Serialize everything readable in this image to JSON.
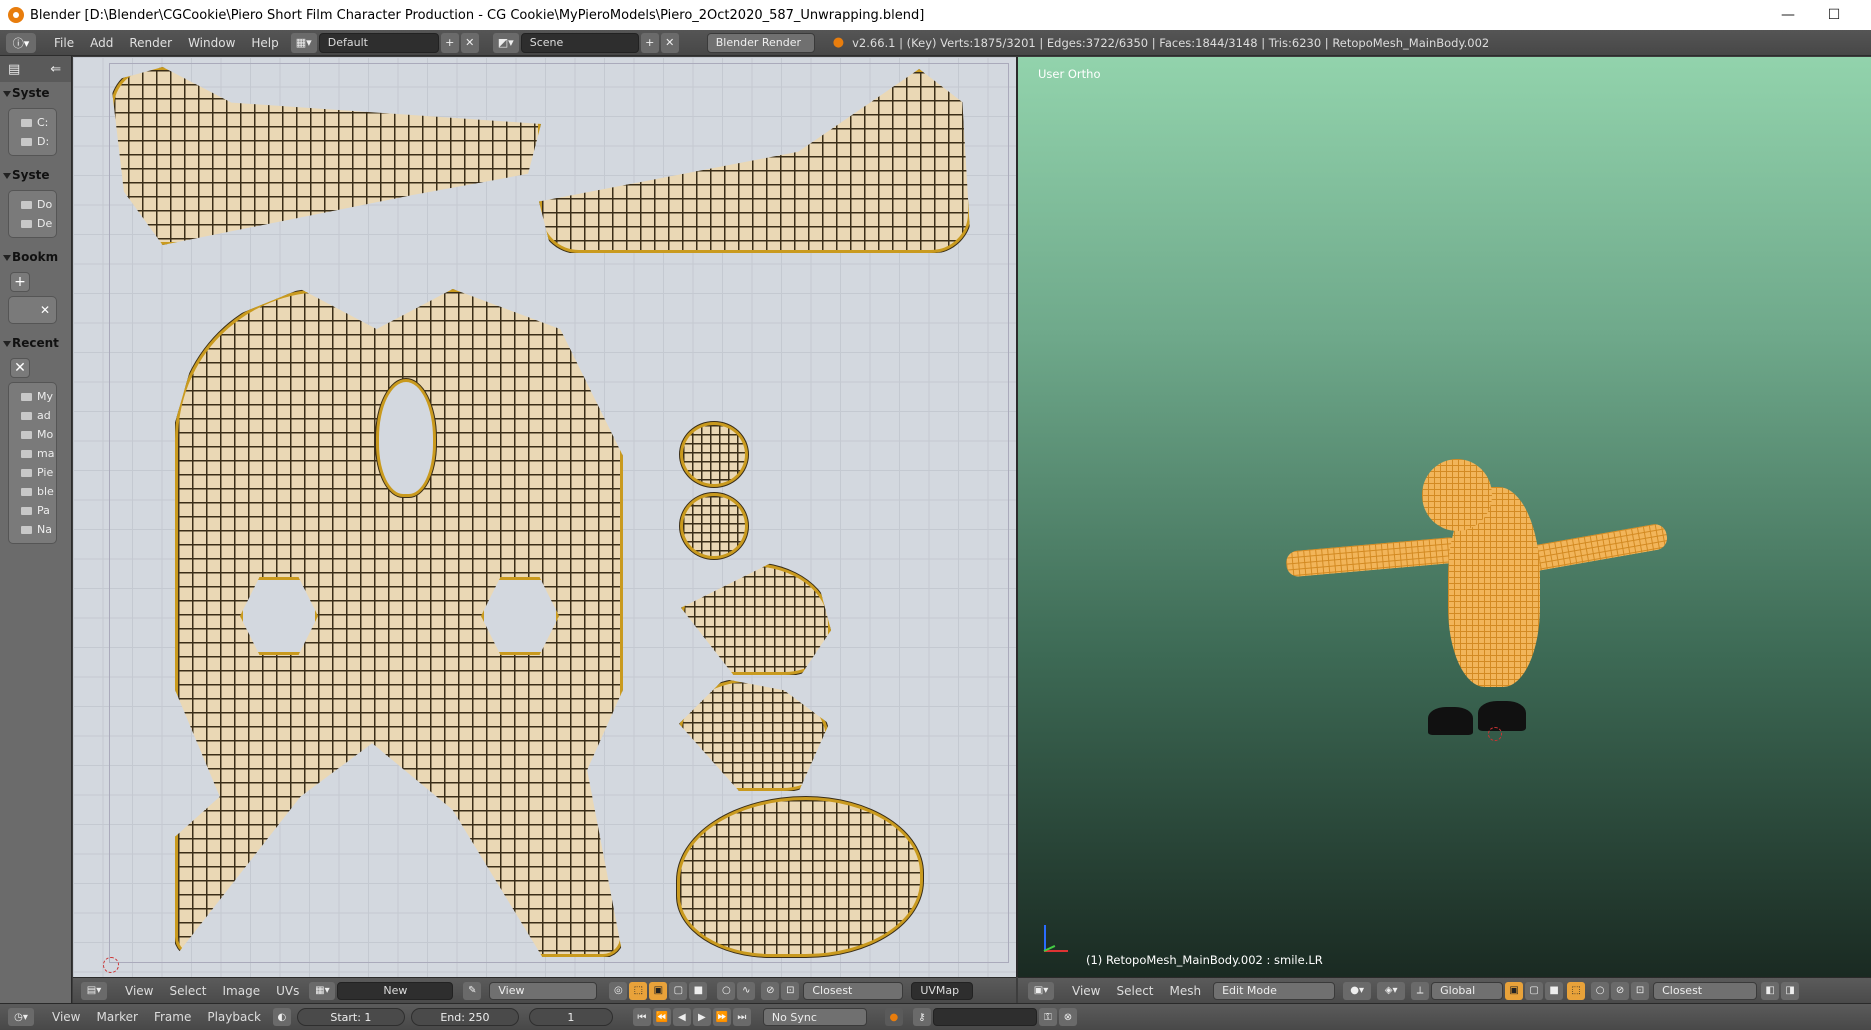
{
  "window": {
    "title": "Blender [D:\\Blender\\CGCookie\\Piero Short Film Character Production - CG Cookie\\MyPieroModels\\Piero_2Oct2020_587_Unwrapping.blend]",
    "minimize": "—",
    "maximize": "☐"
  },
  "menubar": {
    "menus": [
      "File",
      "Add",
      "Render",
      "Window",
      "Help"
    ],
    "screen_layout": "Default",
    "scene": "Scene",
    "render_engine": "Blender Render",
    "stats": "v2.66.1 | (Key) Verts:1875/3201 | Edges:3722/6350 | Faces:1844/3148 | Tris:6230 | RetopoMesh_MainBody.002"
  },
  "file_browser_panel": {
    "sections": [
      {
        "label": "Syste",
        "items": [
          "C:",
          "D:"
        ]
      },
      {
        "label": "Syste",
        "items": [
          "Do",
          "De"
        ]
      },
      {
        "label": "Bookm",
        "items": []
      },
      {
        "label": "Recent",
        "items": [
          "My",
          "ad",
          "Mo",
          "ma",
          "Pie",
          "ble",
          "Pa",
          "Na"
        ]
      }
    ]
  },
  "uv_editor": {
    "header": {
      "menus": [
        "View",
        "Select",
        "Image",
        "UVs"
      ],
      "new_button": "New",
      "view_select": "View",
      "snap_select": "Closest",
      "uv_map": "UVMap"
    }
  },
  "viewport": {
    "view_label": "User Ortho",
    "object_label": "(1) RetopoMesh_MainBody.002 : smile.LR",
    "header": {
      "menus": [
        "View",
        "Select",
        "Mesh"
      ],
      "mode": "Edit Mode",
      "orientation": "Global",
      "snap_select": "Closest"
    }
  },
  "timeline": {
    "menus": [
      "View",
      "Marker",
      "Frame",
      "Playback"
    ],
    "start": "Start: 1",
    "end": "End: 250",
    "current_frame": "1",
    "sync": "No Sync"
  },
  "colors": {
    "uv_edge": "#c99a1e",
    "uv_face": "#ead8b5",
    "mesh_select": "#f2b55a",
    "viewport_top": "#92d3ac",
    "viewport_bottom": "#1a2a22"
  }
}
